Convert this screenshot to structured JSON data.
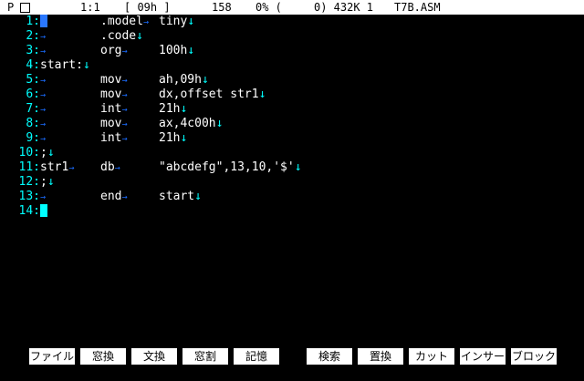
{
  "status": {
    "mode": "P",
    "pos": "1:1",
    "char": "[ 09h ]",
    "count": "158",
    "percent": "0% (",
    "mem": "0) 432K 1",
    "file": "T7B.ASM"
  },
  "lines": [
    {
      "n": "1:",
      "label": "",
      "op": ".model",
      "arg": "tiny"
    },
    {
      "n": "2:",
      "label": "",
      "op": ".code",
      "arg": ""
    },
    {
      "n": "3:",
      "label": "",
      "op": "org",
      "arg": "100h"
    },
    {
      "n": "4:",
      "label": "start:",
      "op": "",
      "arg": ""
    },
    {
      "n": "5:",
      "label": "",
      "op": "mov",
      "arg": "ah,09h"
    },
    {
      "n": "6:",
      "label": "",
      "op": "mov",
      "arg": "dx,offset str1"
    },
    {
      "n": "7:",
      "label": "",
      "op": "int",
      "arg": "21h"
    },
    {
      "n": "8:",
      "label": "",
      "op": "mov",
      "arg": "ax,4c00h"
    },
    {
      "n": "9:",
      "label": "",
      "op": "int",
      "arg": "21h"
    },
    {
      "n": "10:",
      "label": ";",
      "op": "",
      "arg": ""
    },
    {
      "n": "11:",
      "label": "str1",
      "op": "db",
      "arg": "\"abcdefg\",13,10,'$'"
    },
    {
      "n": "12:",
      "label": ";",
      "op": "",
      "arg": ""
    },
    {
      "n": "13:",
      "label": "",
      "op": "end",
      "arg": "start"
    },
    {
      "n": "14:",
      "label": "",
      "op": "",
      "arg": ""
    }
  ],
  "fkeys": [
    "ファイル",
    "窓換",
    "文換",
    "窓割",
    "記憶",
    "検索",
    "置換",
    "カット",
    "インサート",
    "ブロック"
  ],
  "colors": {
    "lineno": "#00ffff",
    "text": "#ffffff",
    "tab": "#1a6cff",
    "bg": "#000000"
  }
}
